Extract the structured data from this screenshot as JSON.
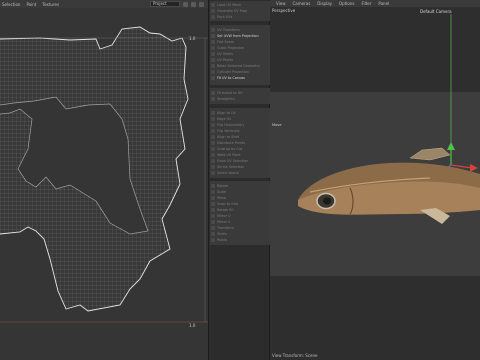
{
  "uv_editor": {
    "menu": [
      "Selection",
      "Paint",
      "Textures"
    ],
    "project_dropdown": "Project",
    "scale_marks": [
      "1.0",
      "1.0"
    ]
  },
  "tools": {
    "items": [
      {
        "label": "Load UV Mesh",
        "active": false
      },
      {
        "label": "Generate UV Map",
        "active": false
      },
      {
        "label": "Pack UVs",
        "active": false
      },
      {
        "label": "UV Transform",
        "active": false
      },
      {
        "label": "Set UVW from Projection",
        "active": true
      },
      {
        "label": "Flat Seam",
        "active": false
      },
      {
        "label": "Cubic Projection",
        "active": false
      },
      {
        "label": "UV Shells",
        "active": false
      },
      {
        "label": "UV Peeler",
        "active": false
      },
      {
        "label": "Relax Selected Geometry",
        "active": false
      },
      {
        "label": "Cylinder Projection",
        "active": false
      },
      {
        "label": "Fit UV to Canvas",
        "active": true
      },
      {
        "label": "Fit Island to UV",
        "active": false
      },
      {
        "label": "Straighten",
        "active": false
      },
      {
        "label": "Align to UV",
        "active": false
      },
      {
        "label": "Edge UV",
        "active": false
      },
      {
        "label": "Flip Horizontally",
        "active": false
      },
      {
        "label": "Flip Vertically",
        "active": false
      },
      {
        "label": "Align to Shell",
        "active": false
      },
      {
        "label": "Distribute Points",
        "active": false
      },
      {
        "label": "Unwrap by Cut",
        "active": false
      },
      {
        "label": "Weld UV Point",
        "active": false
      },
      {
        "label": "Grow UV Selection",
        "active": false
      },
      {
        "label": "Shrink Selection",
        "active": false
      },
      {
        "label": "Select Island",
        "active": false
      },
      {
        "label": "Rotate",
        "active": false
      },
      {
        "label": "Scale",
        "active": false
      },
      {
        "label": "Move",
        "active": false
      },
      {
        "label": "Snap to Grid",
        "active": false
      },
      {
        "label": "Rotate 90",
        "active": false
      },
      {
        "label": "Mirror U",
        "active": false
      },
      {
        "label": "Mirror V",
        "active": false
      },
      {
        "label": "Transform",
        "active": false
      },
      {
        "label": "Shells",
        "active": false
      },
      {
        "label": "Points",
        "active": false
      }
    ]
  },
  "viewport": {
    "menu": [
      "View",
      "Cameras",
      "Display",
      "Options",
      "Filter",
      "Panel"
    ],
    "perspective_label": "Perspective",
    "camera_label": "Default Camera",
    "move_label": "Move",
    "status_label": "View Transform: Scene",
    "colors": {
      "axis_x": "#d8413a",
      "axis_y": "#4fc24a",
      "axis_z": "#4a6fd4"
    }
  }
}
